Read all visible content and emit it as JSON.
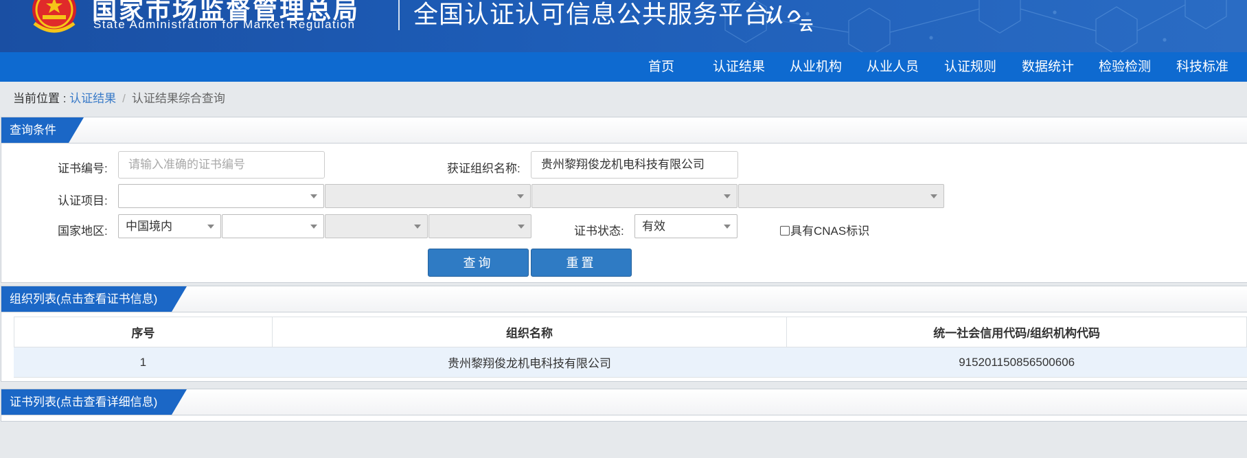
{
  "header": {
    "agency_cn": "国家市场监督管理总局",
    "agency_en": "State Administration  for  Market Regulation",
    "platform_title": "全国认证认可信息公共服务平台",
    "logo_text_1": "认",
    "logo_text_2": "云"
  },
  "nav": {
    "items": [
      {
        "label": "首页"
      },
      {
        "label": "认证结果"
      },
      {
        "label": "从业机构"
      },
      {
        "label": "从业人员"
      },
      {
        "label": "认证规则"
      },
      {
        "label": "数据统计"
      },
      {
        "label": "检验检测"
      },
      {
        "label": "科技标准"
      }
    ]
  },
  "breadcrumb": {
    "prefix": "当前位置 : ",
    "link": "认证结果",
    "separator": "/",
    "current": "认证结果综合查询"
  },
  "query": {
    "panel_title": "查询条件",
    "cert_no_label": "证书编号:",
    "cert_no_placeholder": "请输入准确的证书编号",
    "cert_no_value": "",
    "org_name_label": "获证组织名称:",
    "org_name_value": "贵州黎翔俊龙机电科技有限公司",
    "project_label": "认证项目:",
    "project_selects": [
      "",
      "",
      "",
      ""
    ],
    "region_label": "国家地区:",
    "region_selects": [
      "中国境内",
      "",
      "",
      ""
    ],
    "status_label": "证书状态:",
    "status_value": "有效",
    "cnas_label": "具有CNAS标识",
    "search_button": "查询",
    "reset_button": "重置"
  },
  "org_list": {
    "panel_title": "组织列表(点击查看证书信息)",
    "columns": [
      "序号",
      "组织名称",
      "统一社会信用代码/组织机构代码"
    ],
    "rows": [
      [
        "1",
        "贵州黎翔俊龙机电科技有限公司",
        "915201150856500606"
      ]
    ]
  },
  "cert_list": {
    "panel_title": "证书列表(点击查看详细信息)"
  },
  "colors": {
    "banner": "#1d5cb6",
    "nav": "#0e6ad0",
    "button": "#2f7bc4",
    "link": "#3a7bc8",
    "row_highlight": "#eaf2fb"
  }
}
